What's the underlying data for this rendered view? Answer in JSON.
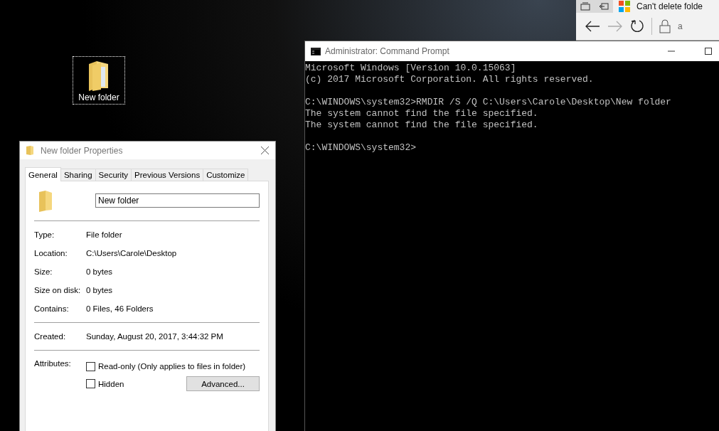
{
  "desktop_icon": {
    "label": "New folder",
    "selected": true
  },
  "browser": {
    "tab_title": "Can't delete folde",
    "address_text": "a"
  },
  "command_prompt": {
    "title": "Administrator: Command Prompt",
    "blocks": [
      [
        "Microsoft Windows [Version 10.0.15063]",
        "(c) 2017 Microsoft Corporation. All rights reserved."
      ],
      [
        "C:\\WINDOWS\\system32>RMDIR /S /Q C:\\Users\\Carole\\Desktop\\New folder",
        "The system cannot find the file specified.",
        "The system cannot find the file specified."
      ],
      [
        "C:\\WINDOWS\\system32>"
      ]
    ]
  },
  "properties": {
    "title": "New folder Properties",
    "tabs": [
      {
        "label": "General",
        "selected": true
      },
      {
        "label": "Sharing",
        "selected": false
      },
      {
        "label": "Security",
        "selected": false
      },
      {
        "label": "Previous Versions",
        "selected": false
      },
      {
        "label": "Customize",
        "selected": false
      }
    ],
    "name_field": {
      "value": "New folder"
    },
    "groups": [
      [
        {
          "label": "Type:",
          "value": "File folder"
        },
        {
          "label": "Location:",
          "value": "C:\\Users\\Carole\\Desktop"
        },
        {
          "label": "Size:",
          "value": "0 bytes"
        },
        {
          "label": "Size on disk:",
          "value": "0 bytes"
        },
        {
          "label": "Contains:",
          "value": "0 Files, 46 Folders"
        }
      ],
      [
        {
          "label": "Created:",
          "value": "Sunday, August 20, 2017, 3:44:32 PM"
        }
      ]
    ],
    "attributes_label": "Attributes:",
    "checkboxes": [
      {
        "label": "Read-only (Only applies to files in folder)",
        "checked": false
      },
      {
        "label": "Hidden",
        "checked": false
      }
    ],
    "advanced_button": "Advanced..."
  }
}
